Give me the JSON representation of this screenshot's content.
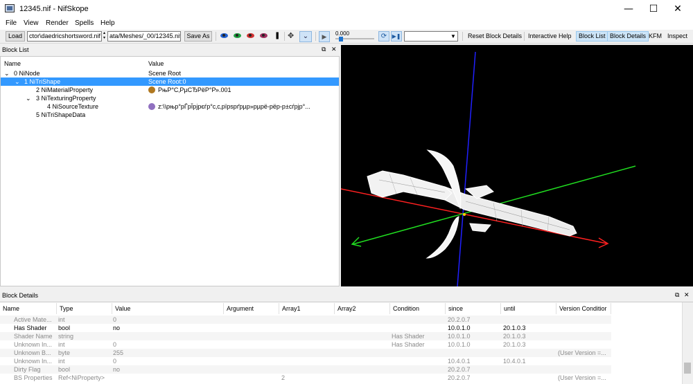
{
  "window": {
    "title": "12345.nif - NifSkope",
    "minimize": "—",
    "maximize": "☐",
    "close": "✕"
  },
  "menu": [
    "File",
    "View",
    "Render",
    "Spells",
    "Help"
  ],
  "toolbar": {
    "load_label": "Load",
    "path_value": "ctor\\daedricshortsword.nif",
    "nif_value": "ata/Meshes/_00/12345.nif",
    "save_as_label": "Save As",
    "time_value": "0.000",
    "reset_block_details": "Reset Block Details",
    "interactive_help": "Interactive Help",
    "block_list": "Block List",
    "block_details": "Block Details",
    "kfm": "KFM",
    "inspect": "Inspect"
  },
  "block_list": {
    "title": "Block List",
    "col_name": "Name",
    "col_value": "Value",
    "rows": [
      {
        "name": "0 NiNode",
        "value": "Scene Root"
      },
      {
        "name": "1 NiTriShape",
        "value": "Scene Root:0"
      },
      {
        "name": "2 NiMaterialProperty",
        "value": "РњР°С‚РµСЂРёР°Р».001"
      },
      {
        "name": "3 NiTexturingProperty",
        "value": ""
      },
      {
        "name": "4 NiSourceTexture",
        "value": "z:\\\\рњр°рЃрЇрјрєѓр°с‚с‚рїрѕрґрµр»рµрё-рёр-р±сѓрјр°..."
      },
      {
        "name": "5 NiTriShapeData",
        "value": ""
      }
    ],
    "expand_icons": [
      "⌄",
      "⌄",
      "⌄"
    ]
  },
  "block_details": {
    "title": "Block Details",
    "columns": [
      "Name",
      "Type",
      "Value",
      "Argument",
      "Array1",
      "Array2",
      "Condition",
      "since",
      "until",
      "Version Conditior"
    ],
    "rows": [
      {
        "name": "Active Mate...",
        "type": "int",
        "value": "0",
        "argument": "",
        "array1": "",
        "array2": "",
        "condition": "",
        "since": "20.2.0.7",
        "until": "",
        "vcond": ""
      },
      {
        "name": "Has Shader",
        "type": "bool",
        "value": "no",
        "argument": "",
        "array1": "",
        "array2": "",
        "condition": "",
        "since": "10.0.1.0",
        "until": "20.1.0.3",
        "vcond": ""
      },
      {
        "name": "Shader Name",
        "type": "string",
        "value": "",
        "argument": "",
        "array1": "",
        "array2": "",
        "condition": "Has Shader",
        "since": "10.0.1.0",
        "until": "20.1.0.3",
        "vcond": ""
      },
      {
        "name": "Unknown In...",
        "type": "int",
        "value": "0",
        "argument": "",
        "array1": "",
        "array2": "",
        "condition": "Has Shader",
        "since": "10.0.1.0",
        "until": "20.1.0.3",
        "vcond": ""
      },
      {
        "name": "Unknown B...",
        "type": "byte",
        "value": "255",
        "argument": "",
        "array1": "",
        "array2": "",
        "condition": "",
        "since": "",
        "until": "",
        "vcond": "(User Version =..."
      },
      {
        "name": "Unknown In...",
        "type": "int",
        "value": "0",
        "argument": "",
        "array1": "",
        "array2": "",
        "condition": "",
        "since": "10.4.0.1",
        "until": "10.4.0.1",
        "vcond": ""
      },
      {
        "name": "Dirty Flag",
        "type": "bool",
        "value": "no",
        "argument": "",
        "array1": "",
        "array2": "",
        "condition": "",
        "since": "20.2.0.7",
        "until": "",
        "vcond": ""
      },
      {
        "name": "BS Properties",
        "type": "Ref<NiProperty>",
        "value": "",
        "argument": "",
        "array1": "2",
        "array2": "",
        "condition": "",
        "since": "20.2.0.7",
        "until": "",
        "vcond": "(User Version =..."
      }
    ]
  },
  "panel_controls": {
    "float": "⧉",
    "close": "✕"
  },
  "colors": {
    "selection": "#3399ff",
    "x_axis": "#ff2020",
    "y_axis": "#20dd20",
    "z_axis": "#2020ff",
    "viewport_bg": "#000000"
  }
}
